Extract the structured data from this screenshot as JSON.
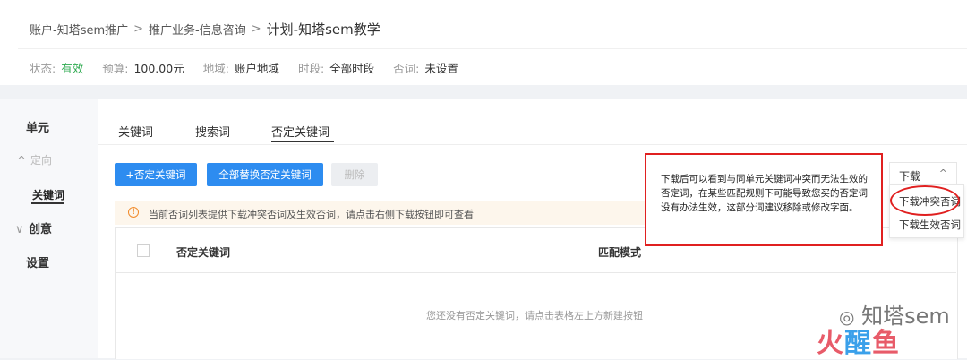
{
  "breadcrumb": {
    "account": "账户-知塔sem推广",
    "separator": ">",
    "promotion": "推广业务-信息咨询",
    "plan": "计划-知塔sem教学"
  },
  "meta": {
    "status_key": "状态:",
    "status_value": "有效",
    "budget_key": "预算:",
    "budget_value": "100.00元",
    "region_key": "地域:",
    "region_value": "账户地域",
    "time_key": "时段:",
    "time_value": "全部时段",
    "negative_key": "否词:",
    "negative_value": "未设置",
    "status_color": "#2eaa50"
  },
  "sidebar": {
    "unit": "单元",
    "targeting": "定向",
    "keywords": "关键词",
    "creative": "创意",
    "settings": "设置"
  },
  "tabs": {
    "keywords": "关键词",
    "search_terms": "搜索词",
    "negative_keywords": "否定关键词"
  },
  "toolbar": {
    "add_negative": "+否定关键词",
    "replace_all": "全部替换否定关键词",
    "delete": "删除",
    "accent": "#2d8cf0"
  },
  "notice": {
    "text": "当前否词列表提供下载冲突否词及生效否词，请点击右侧下载按钮即可查看"
  },
  "table": {
    "headers": [
      "否定关键词",
      "匹配模式"
    ],
    "empty_text": "您还没有否定关键词，请点击表格左上方新建按钮"
  },
  "download": {
    "label": "下载",
    "items": [
      "下载冲突否词",
      "下载生效否词"
    ]
  },
  "callout": {
    "text": "下载后可以看到与同单元关键词冲突而无法生效的否定词，在某些匹配规则下可能导致您买的否定词没有办法生效，这部分词建议移除或修改字面。"
  },
  "watermark": {
    "text": "知塔sem",
    "logo_a": "火",
    "logo_b": "醒",
    "logo_c": "鱼"
  }
}
